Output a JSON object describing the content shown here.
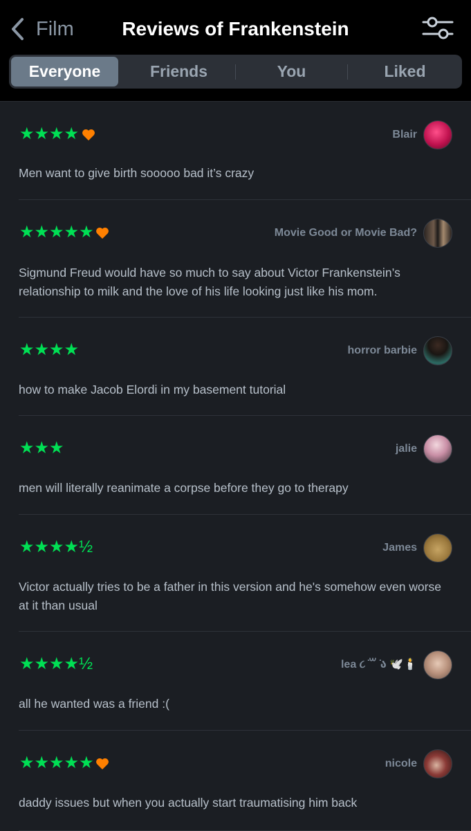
{
  "header": {
    "back_label": "Film",
    "title": "Reviews of Frankenstein"
  },
  "tabs": [
    {
      "label": "Everyone",
      "active": true
    },
    {
      "label": "Friends",
      "active": false
    },
    {
      "label": "You",
      "active": false
    },
    {
      "label": "Liked",
      "active": false
    }
  ],
  "colors": {
    "star": "#00e054",
    "heart": "#ff8000",
    "background": "#1b1e23"
  },
  "reviews": [
    {
      "user": "Blair",
      "rating": 4,
      "stars_text": "★★★★",
      "liked": true,
      "text": "Men want to give birth sooooo bad it’s crazy"
    },
    {
      "user": "Movie Good or Movie Bad?",
      "rating": 5,
      "stars_text": "★★★★★",
      "liked": true,
      "text": "Sigmund Freud would have so much to say about Victor Frankenstein’s relationship to milk and the love of his life looking just like his mom."
    },
    {
      "user": "horror barbie",
      "rating": 4,
      "stars_text": "★★★★",
      "liked": false,
      "text": "how to make Jacob Elordi in my basement tutorial"
    },
    {
      "user": "jalie",
      "rating": 3,
      "stars_text": "★★★",
      "liked": false,
      "text": "men will literally reanimate a corpse before they go to therapy"
    },
    {
      "user": "James",
      "rating": 4.5,
      "stars_text": "★★★★½",
      "liked": false,
      "text": "Victor actually tries to be a father in this version and he's somehow even worse at it than usual"
    },
    {
      "user": "lea ૮ ̇꒳ ̇ა 🕊️🕯️",
      "rating": 4.5,
      "stars_text": "★★★★½",
      "liked": false,
      "text": "all he wanted was a friend :("
    },
    {
      "user": "nicole",
      "rating": 5,
      "stars_text": "★★★★★",
      "liked": true,
      "text": "daddy issues but when you actually start traumatising him back"
    }
  ]
}
